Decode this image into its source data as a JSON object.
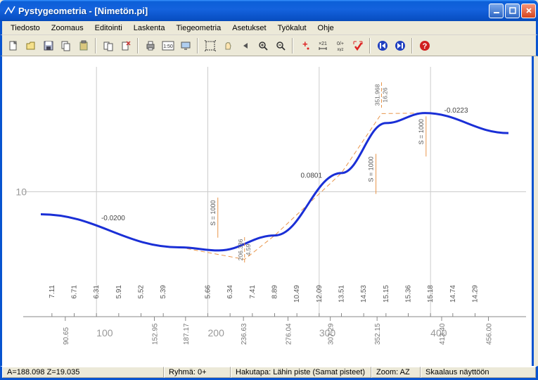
{
  "window": {
    "title": "Pystygeometria - [Nimetön.pi]"
  },
  "menu": {
    "items": [
      "Tiedosto",
      "Zoomaus",
      "Editointi",
      "Laskenta",
      "Tiegeometria",
      "Asetukset",
      "Työkalut",
      "Ohje"
    ]
  },
  "status": {
    "coords": "A=188.098  Z=19.035",
    "group": "Ryhmä: 0+",
    "pickmode": "Hakutapa: Lähin piste (Samat pisteet)",
    "zoom": "Zoom: AZ",
    "scale": "Skaalaus näyttöön"
  },
  "chart_data": {
    "type": "line",
    "xlabel": "",
    "ylabel": "",
    "ylim": [
      0,
      20
    ],
    "xlim": [
      50,
      470
    ],
    "y_tick_labels": [
      "10"
    ],
    "x_major_ticks": [
      100,
      200,
      300,
      400
    ],
    "slope_labels": [
      {
        "text": "-0.0200",
        "x": 115,
        "y": 7.5
      },
      {
        "text": "0.0801",
        "x": 293,
        "y": 10.9
      },
      {
        "text": "-0.0223",
        "x": 423,
        "y": 16.1
      }
    ],
    "curve_annotations": [
      {
        "text": "S = 1000",
        "x": 209,
        "y": 7.0
      },
      {
        "text": "S = 1000",
        "x": 351,
        "y": 10.5
      },
      {
        "text": "S = 1000",
        "x": 396,
        "y": 13.5
      }
    ],
    "vertex_annotations": [
      {
        "text_a": "206.336",
        "text_b": "4.59",
        "x": 233
      },
      {
        "text_a": "351.968",
        "text_b": "16.26",
        "x": 356
      }
    ],
    "profile_points": [
      {
        "x": 50,
        "y": 8.2
      },
      {
        "x": 175,
        "y": 5.55
      },
      {
        "x": 210,
        "y": 5.3
      },
      {
        "x": 260,
        "y": 6.5
      },
      {
        "x": 320,
        "y": 11.5
      },
      {
        "x": 360,
        "y": 15.5
      },
      {
        "x": 395,
        "y": 16.3
      },
      {
        "x": 470,
        "y": 14.7
      }
    ],
    "tangent_breaks": [
      {
        "x": 175,
        "y": 5.55
      },
      {
        "x": 233,
        "y": 4.59
      },
      {
        "x": 260,
        "y": 6.5
      },
      {
        "x": 320,
        "y": 11.5
      },
      {
        "x": 356,
        "y": 16.26
      },
      {
        "x": 395,
        "y": 16.3
      }
    ],
    "bottom_labels": [
      {
        "x": 60,
        "label": "7.11"
      },
      {
        "x": 80,
        "label": "6.71"
      },
      {
        "x": 100,
        "label": "6.31"
      },
      {
        "x": 120,
        "label": "5.91"
      },
      {
        "x": 140,
        "label": "5.52"
      },
      {
        "x": 160,
        "label": "5.39"
      },
      {
        "x": 200,
        "label": "5.66"
      },
      {
        "x": 220,
        "label": "6.34"
      },
      {
        "x": 240,
        "label": "7.41"
      },
      {
        "x": 260,
        "label": "8.89"
      },
      {
        "x": 280,
        "label": "10.49"
      },
      {
        "x": 300,
        "label": "12.09"
      },
      {
        "x": 320,
        "label": "13.51"
      },
      {
        "x": 340,
        "label": "14.53"
      },
      {
        "x": 360,
        "label": "15.15"
      },
      {
        "x": 380,
        "label": "15.36"
      },
      {
        "x": 400,
        "label": "15.18"
      },
      {
        "x": 420,
        "label": "14.74"
      },
      {
        "x": 440,
        "label": "14.29"
      }
    ],
    "axis_y_labels": [
      {
        "x": 72,
        "label": "90.65"
      },
      {
        "x": 152,
        "label": "152.95"
      },
      {
        "x": 180,
        "label": "187.17"
      },
      {
        "x": 232,
        "label": "236.63"
      },
      {
        "x": 272,
        "label": "276.04"
      },
      {
        "x": 310,
        "label": "307.29"
      },
      {
        "x": 352,
        "label": "352.15"
      },
      {
        "x": 410,
        "label": "413.40"
      },
      {
        "x": 452,
        "label": "456.00"
      }
    ]
  }
}
